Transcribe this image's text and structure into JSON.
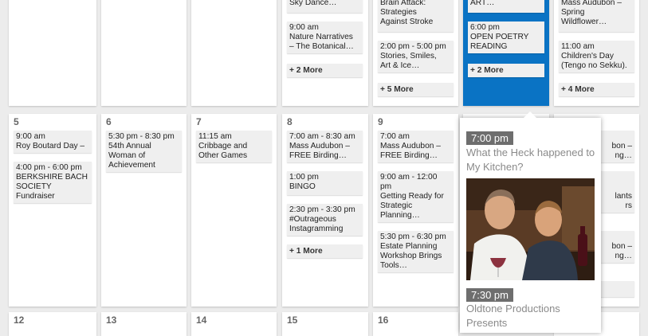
{
  "row1": {
    "d4": {
      "events": [
        {
          "time": "",
          "lines": [
            "Sky Dance…"
          ]
        },
        {
          "time": "9:00 am",
          "lines": [
            "Nature Narratives",
            "– The Botanical…"
          ]
        }
      ],
      "more": "+ 2 More"
    },
    "d5": {
      "events": [
        {
          "time": "",
          "lines": [
            "Brain Attack:",
            "Strategies",
            "Against Stroke"
          ]
        },
        {
          "time": "2:00 pm - 5:00 pm",
          "lines": [
            "Stories, Smiles,",
            "Art & Ice…"
          ]
        }
      ],
      "more": "+ 5 More"
    },
    "d6": {
      "events": [
        {
          "time": "",
          "lines": [
            "ART…"
          ]
        },
        {
          "time": "6:00 pm",
          "lines": [
            "OPEN POETRY",
            "READING"
          ]
        }
      ],
      "more": "+ 2 More"
    },
    "d7": {
      "events": [
        {
          "time": "",
          "lines": [
            "Mass Audubon –",
            "Spring",
            "Wildflower…"
          ]
        },
        {
          "time": "11:00 am",
          "lines": [
            "Children's Day",
            "(Tengo no Sekku)."
          ]
        }
      ],
      "more": "+ 4 More"
    }
  },
  "row2": {
    "d1": {
      "num": "5",
      "events": [
        {
          "time": "9:00 am",
          "lines": [
            "Roy Boutard Day –"
          ]
        },
        {
          "time": "4:00 pm - 6:00 pm",
          "lines": [
            "BERKSHIRE BACH",
            "SOCIETY",
            "Fundraiser"
          ]
        }
      ]
    },
    "d2": {
      "num": "6",
      "events": [
        {
          "time": "5:30 pm - 8:30 pm",
          "lines": [
            "54th Annual",
            "Woman of",
            "Achievement"
          ]
        }
      ]
    },
    "d3": {
      "num": "7",
      "events": [
        {
          "time": "11:15 am",
          "lines": [
            "Cribbage and",
            "Other Games"
          ]
        }
      ]
    },
    "d4": {
      "num": "8",
      "events": [
        {
          "time": "7:00 am - 8:30 am",
          "lines": [
            "Mass Audubon –",
            "FREE Birding…"
          ]
        },
        {
          "time": "1:00 pm",
          "lines": [
            "BINGO"
          ]
        },
        {
          "time": "2:30 pm - 3:30 pm",
          "lines": [
            "#Outrageous",
            "Instagramming"
          ]
        }
      ],
      "more": "+ 1 More"
    },
    "d5": {
      "num": "9",
      "events": [
        {
          "time": "7:00 am",
          "lines": [
            "Mass Audubon –",
            "FREE Birding…"
          ]
        },
        {
          "time": "9:00 am - 12:00",
          "lines": [
            "pm",
            "Getting Ready for",
            "Strategic",
            "Planning…"
          ]
        },
        {
          "time": "5:30 pm - 6:30 pm",
          "lines": [
            "Estate Planning",
            "Workshop Brings",
            "Tools…"
          ]
        }
      ]
    },
    "d7": {
      "events": [
        {
          "lines": [
            "bon –",
            "ng…"
          ]
        },
        {
          "lines": [
            "lants",
            "rs"
          ]
        },
        {
          "lines": [
            "bon –",
            "ng…"
          ]
        }
      ]
    }
  },
  "row3": [
    "12",
    "13",
    "14",
    "15",
    "16"
  ],
  "popup": {
    "time1": "7:00 pm",
    "title1": "What the Heck happened to My Kitchen?",
    "time2": "7:30 pm",
    "title2": "Oldtone Productions Presents"
  },
  "colors": {
    "selected": "#0a73c4",
    "badge": "#6e6e6e",
    "event_bg": "#efefef"
  }
}
